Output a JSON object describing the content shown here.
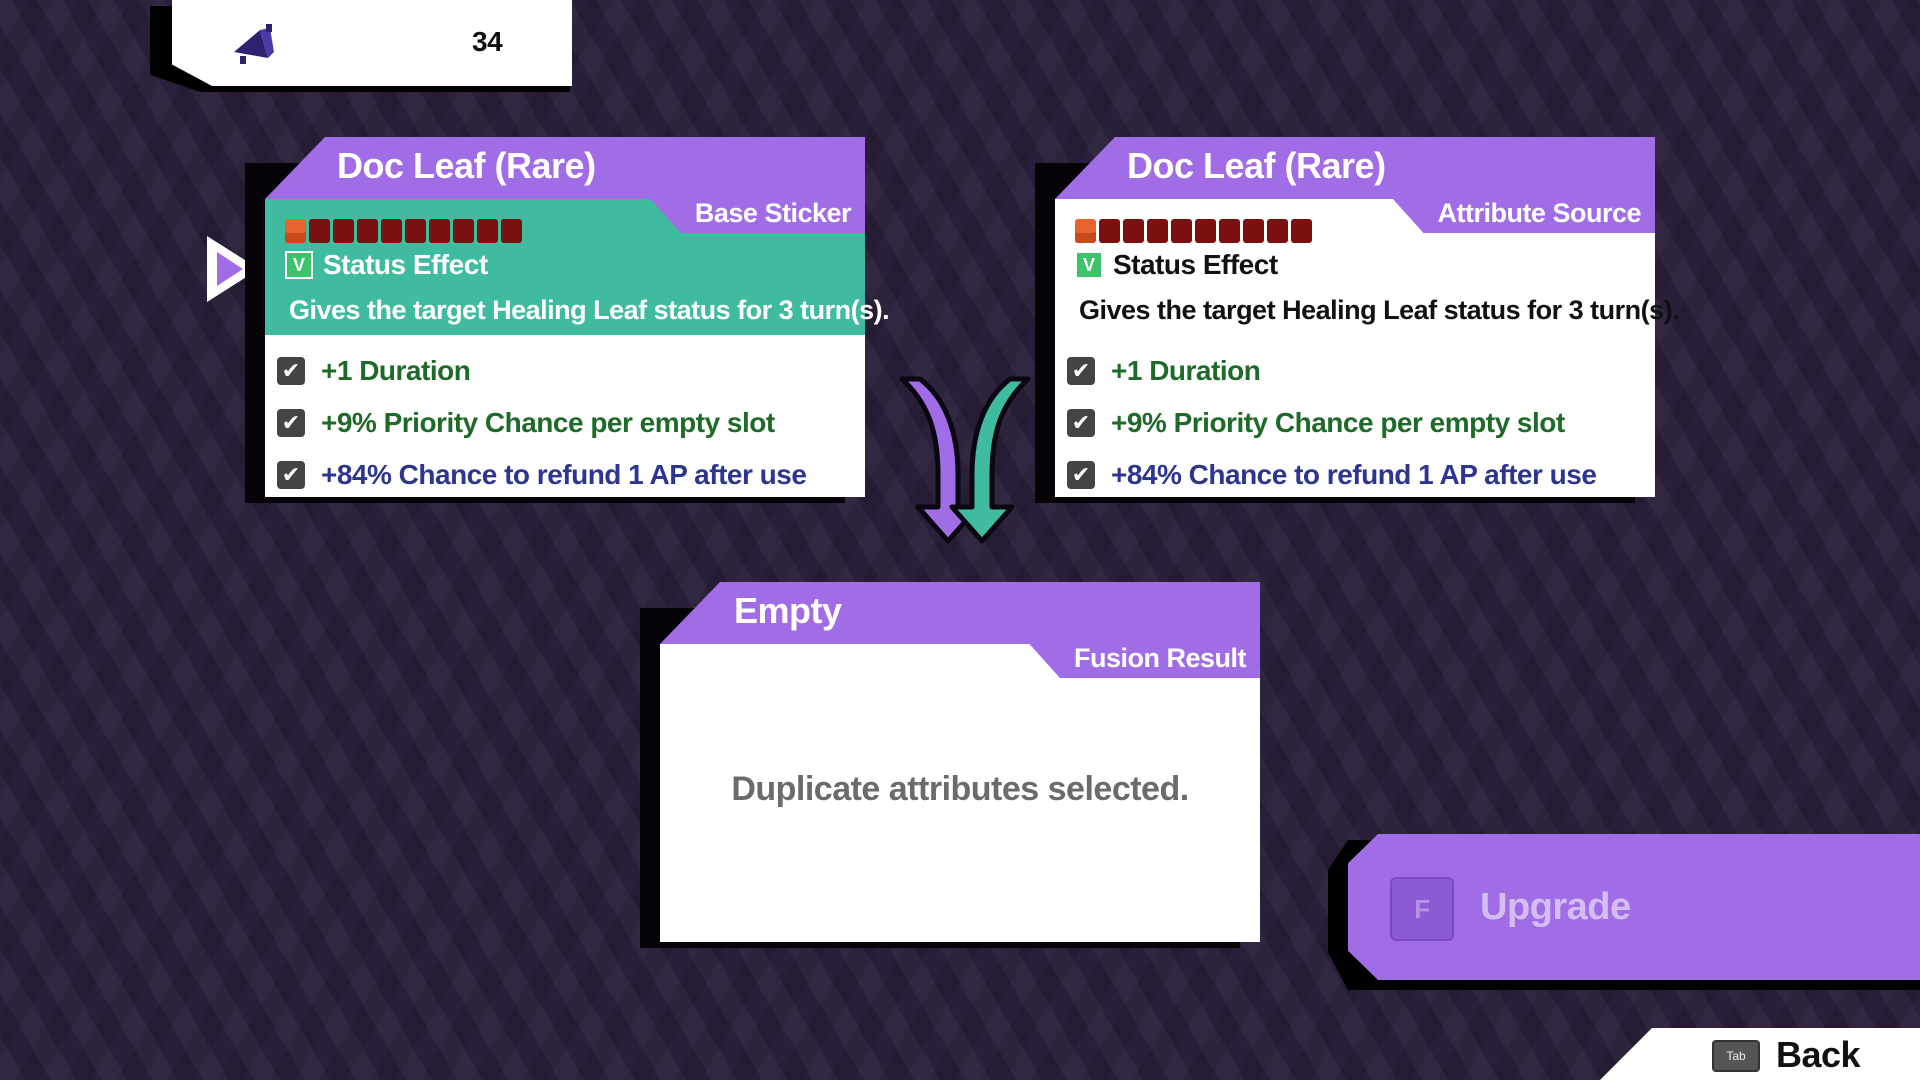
{
  "currency": {
    "icon": "megaphone-icon",
    "count": "34"
  },
  "cards": [
    {
      "title": "Doc Leaf (Rare)",
      "tab": "Base Sticker",
      "type_label": "Status Effect",
      "description": "Gives the target Healing Leaf status for 3 turn(s).",
      "attributes": [
        {
          "label": "+1 Duration"
        },
        {
          "label": "+9% Priority Chance per empty slot"
        },
        {
          "label": "+84% Chance to refund 1 AP after use"
        }
      ]
    },
    {
      "title": "Doc Leaf (Rare)",
      "tab": "Attribute Source",
      "type_label": "Status Effect",
      "description": "Gives the target Healing Leaf status for 3 turn(s).",
      "attributes": [
        {
          "label": "+1 Duration"
        },
        {
          "label": "+9% Priority Chance per empty slot"
        },
        {
          "label": "+84% Chance to refund 1 AP after use"
        }
      ]
    }
  ],
  "result": {
    "title": "Empty",
    "tab": "Fusion Result",
    "message": "Duplicate attributes selected."
  },
  "upgrade": {
    "key": "F",
    "label": "Upgrade"
  },
  "back": {
    "key": "Tab",
    "label": "Back"
  },
  "colors": {
    "accent_purple": "#a16de6",
    "selected_teal": "#3fbba0",
    "attr_green": "#1e6a28",
    "attr_blue": "#2d3590"
  }
}
